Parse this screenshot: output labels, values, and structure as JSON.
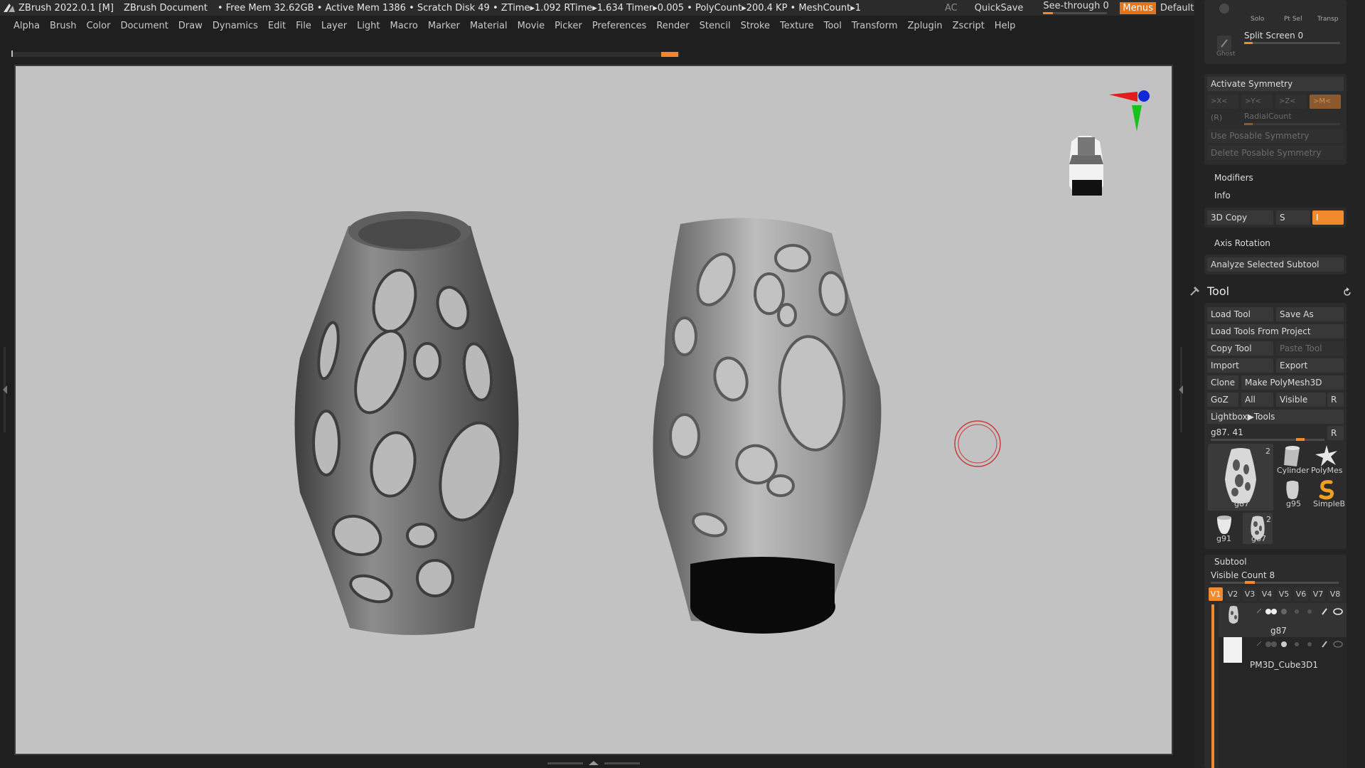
{
  "titlebar": {
    "app": "ZBrush 2022.0.1 [M]",
    "document": "ZBrush Document",
    "stats": "• Free Mem 32.62GB • Active Mem 1386 • Scratch Disk 49 • ZTime▸1.092 RTime▸1.634 Timer▸0.005 • PolyCount▸200.4 KP • MeshCount▸1",
    "ac": "AC",
    "quicksave": "QuickSave",
    "see_through": "See-through  0",
    "see_through_value": 0,
    "menus": "Menus",
    "script": "DefaultZScript"
  },
  "menu": [
    "Alpha",
    "Brush",
    "Color",
    "Document",
    "Draw",
    "Dynamics",
    "Edit",
    "File",
    "Layer",
    "Light",
    "Macro",
    "Marker",
    "Material",
    "Movie",
    "Picker",
    "Preferences",
    "Render",
    "Stencil",
    "Stroke",
    "Texture",
    "Tool",
    "Transform",
    "Zplugin",
    "Zscript",
    "Help"
  ],
  "panel_top": {
    "solo": "Solo",
    "ptsel": "Pt Sel",
    "transp": "Transp",
    "ghost": "Ghost",
    "split_screen": "Split Screen 0"
  },
  "symmetry": {
    "activate": "Activate Symmetry",
    "x": ">X<",
    "y": ">Y<",
    "z": ">Z<",
    "m": ">M<",
    "r": "(R)",
    "radial": "RadialCount",
    "use_posable": "Use Posable Symmetry",
    "delete_posable": "Delete Posable Symmetry"
  },
  "modifiers": "Modifiers",
  "info": "Info",
  "copy3d": {
    "label": "3D Copy",
    "s": "S",
    "i": "I"
  },
  "axis_rotation": "Axis Rotation",
  "analyze": "Analyze Selected Subtool",
  "tool": {
    "title": "Tool",
    "load_tool": "Load Tool",
    "save_as": "Save As",
    "load_from_project": "Load Tools From Project",
    "copy_tool": "Copy Tool",
    "paste_tool": "Paste Tool",
    "import": "Import",
    "export": "Export",
    "clone": "Clone",
    "make_polymesh": "Make PolyMesh3D",
    "goz": "GoZ",
    "all": "All",
    "visible": "Visible",
    "r": "R",
    "lightbox": "Lightbox▶Tools",
    "current": "g87. 41",
    "current_r": "R",
    "thumbs": [
      {
        "label": "g87",
        "badge": "2"
      },
      {
        "label": "Cylinder"
      },
      {
        "label": "PolyMes"
      },
      {
        "label": "g95"
      },
      {
        "label": "SimpleB"
      },
      {
        "label": "g91"
      },
      {
        "label": "g87",
        "badge": "2"
      }
    ]
  },
  "subtool": {
    "title": "Subtool",
    "visible_count": "Visible Count 8",
    "tabs": [
      "V1",
      "V2",
      "V3",
      "V4",
      "V5",
      "V6",
      "V7",
      "V8"
    ],
    "items": [
      {
        "name": "g87"
      },
      {
        "name": "PM3D_Cube3D1"
      }
    ]
  },
  "colors": {
    "accent": "#f08a2c",
    "viewport_bg": "#c2c2c2",
    "panel_bg": "#232323"
  }
}
